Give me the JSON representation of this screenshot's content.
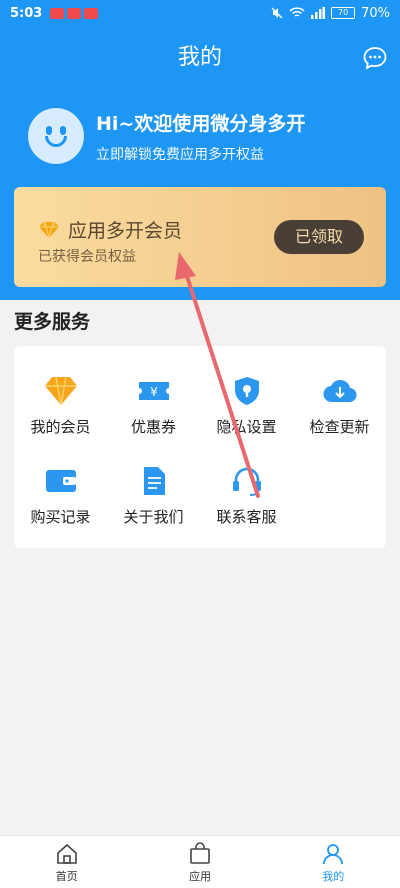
{
  "status_bar": {
    "time": "5:03",
    "battery": "70%",
    "battery_inner": "70"
  },
  "header": {
    "title": "我的"
  },
  "profile": {
    "greeting": "Hi~欢迎使用微分身多开",
    "subtitle": "立即解锁免费应用多开权益"
  },
  "vip_card": {
    "title": "应用多开会员",
    "subtitle": "已获得会员权益",
    "button_label": "已领取"
  },
  "services": {
    "title": "更多服务",
    "items": [
      {
        "label": "我的会员",
        "icon": "diamond-icon"
      },
      {
        "label": "优惠券",
        "icon": "coupon-icon"
      },
      {
        "label": "隐私设置",
        "icon": "shield-lock-icon"
      },
      {
        "label": "检查更新",
        "icon": "cloud-download-icon"
      },
      {
        "label": "购买记录",
        "icon": "wallet-icon"
      },
      {
        "label": "关于我们",
        "icon": "document-icon"
      },
      {
        "label": "联系客服",
        "icon": "headset-icon"
      }
    ]
  },
  "tab_bar": {
    "tabs": [
      {
        "label": "首页",
        "icon": "home-icon"
      },
      {
        "label": "应用",
        "icon": "bag-icon"
      },
      {
        "label": "我的",
        "icon": "person-icon",
        "active": true
      }
    ]
  },
  "colors": {
    "primary": "#1e96f5",
    "vip_gold": "#f5c57a",
    "vip_button": "#4a3f36",
    "arrow": "#e8686e"
  }
}
